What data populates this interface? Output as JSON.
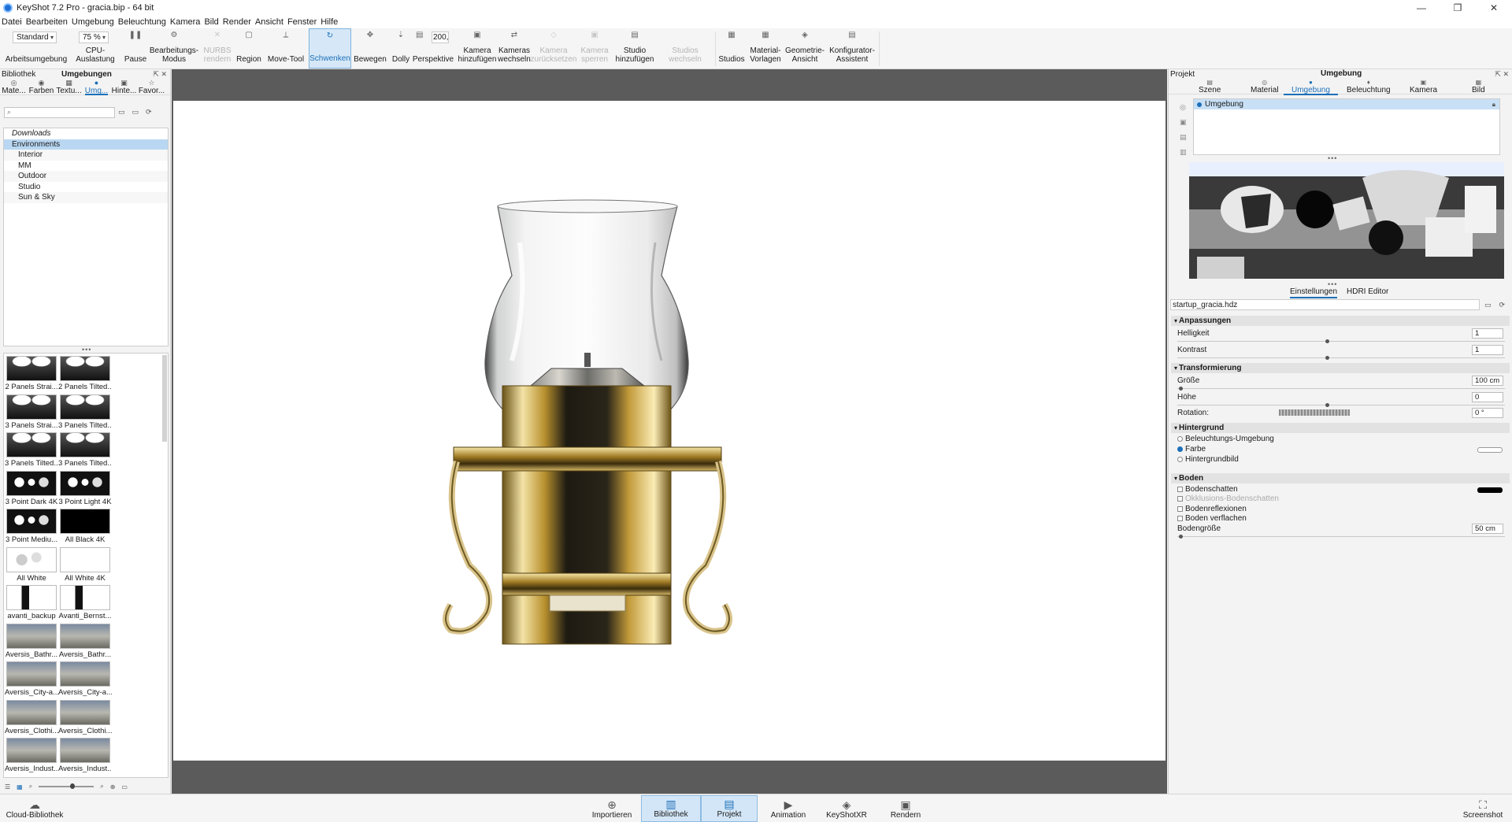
{
  "window": {
    "title": "KeyShot 7.2 Pro  - gracia.bip  - 64 bit",
    "controls": [
      "—",
      "❐",
      "✕"
    ]
  },
  "menu": [
    "Datei",
    "Bearbeiten",
    "Umgebung",
    "Beleuchtung",
    "Kamera",
    "Bild",
    "Render",
    "Ansicht",
    "Fenster",
    "Hilfe"
  ],
  "toolbar": {
    "workspace_select": "Standard",
    "cpu_select": "75 %",
    "perspective_value": "200,",
    "items": [
      {
        "label": "Arbeitsumgebung",
        "icon": "",
        "state": "normal"
      },
      {
        "label": "CPU-Auslastung",
        "icon": "",
        "state": "normal"
      },
      {
        "label": "Pause",
        "icon": "❚❚",
        "state": "normal"
      },
      {
        "label": "Bearbeitungs-\nModus",
        "icon": "⚙",
        "state": "normal"
      },
      {
        "label": "NURBS\nrendern",
        "icon": "✕",
        "state": "disabled"
      },
      {
        "label": "Region",
        "icon": "▢",
        "state": "normal"
      },
      {
        "label": "Move-Tool",
        "icon": "⟂",
        "state": "normal"
      },
      {
        "label": "Schwenken",
        "icon": "↻",
        "state": "active"
      },
      {
        "label": "Bewegen",
        "icon": "✥",
        "state": "normal"
      },
      {
        "label": "Dolly",
        "icon": "⇣",
        "state": "normal"
      },
      {
        "label": "Perspektive",
        "icon": "▤",
        "state": "normal"
      },
      {
        "label": "Kamera\nhinzufügen",
        "icon": "▣",
        "state": "normal"
      },
      {
        "label": "Kameras\nwechseln",
        "icon": "⇄",
        "state": "normal"
      },
      {
        "label": "Kamera\nzurücksetzen",
        "icon": "◇",
        "state": "disabled"
      },
      {
        "label": "Kamera\nsperren",
        "icon": "▣",
        "state": "disabled"
      },
      {
        "label": "Studio\nhinzufügen",
        "icon": "▤",
        "state": "normal"
      },
      {
        "label": "Studios wechseln",
        "icon": "",
        "state": "disabled"
      },
      {
        "label": "Studios",
        "icon": "▦",
        "state": "normal"
      },
      {
        "label": "Material-\nVorlagen",
        "icon": "▦",
        "state": "normal"
      },
      {
        "label": "Geometrie-\nAnsicht",
        "icon": "◈",
        "state": "normal"
      },
      {
        "label": "Konfigurator-\nAssistent",
        "icon": "▤",
        "state": "normal"
      }
    ]
  },
  "library": {
    "header_left": "Bibliothek",
    "header_title": "Umgebungen",
    "tabs": [
      {
        "label": "Mate...",
        "icon": "◎"
      },
      {
        "label": "Farben",
        "icon": "◉"
      },
      {
        "label": "Textu...",
        "icon": "▦"
      },
      {
        "label": "Umg...",
        "icon": "●"
      },
      {
        "label": "Hinte...",
        "icon": "▣"
      },
      {
        "label": "Favor...",
        "icon": "☆"
      }
    ],
    "search_placeholder": "⌕",
    "tree": [
      {
        "label": "Downloads",
        "level": 0,
        "italic": true
      },
      {
        "label": "Environments",
        "level": 0,
        "selected": true
      },
      {
        "label": "Interior",
        "level": 1
      },
      {
        "label": "MM",
        "level": 1
      },
      {
        "label": "Outdoor",
        "level": 1
      },
      {
        "label": "Studio",
        "level": 1
      },
      {
        "label": "Sun & Sky",
        "level": 1
      }
    ],
    "thumbnails": [
      "2 Panels Strai...",
      "2 Panels Tilted...",
      "3 Panels Strai...",
      "3 Panels Tilted...",
      "3 Panels Tilted...",
      "3 Panels Tilted...",
      "3 Point Dark 4K",
      "3 Point Light 4K",
      "3 Point Mediu...",
      "All Black 4K",
      "All White",
      "All White 4K",
      "avanti_backup",
      "Avanti_Bernst...",
      "Aversis_Bathr...",
      "Aversis_Bathr...",
      "Aversis_City-a...",
      "Aversis_City-a...",
      "Aversis_Clothi...",
      "Aversis_Clothi...",
      "Aversis_Indust...",
      "Aversis_Indust..."
    ]
  },
  "project": {
    "header_left": "Projekt",
    "header_title": "Umgebung",
    "tabs": [
      {
        "label": "Szene",
        "icon": "▤"
      },
      {
        "label": "Material",
        "icon": "◎"
      },
      {
        "label": "Umgebung",
        "icon": "●"
      },
      {
        "label": "Beleuchtung",
        "icon": "♦"
      },
      {
        "label": "Kamera",
        "icon": "▣"
      },
      {
        "label": "Bild",
        "icon": "▦"
      }
    ],
    "env_item": "Umgebung",
    "subtabs": [
      "Einstellungen",
      "HDRI Editor"
    ],
    "hdri_file": "startup_gracia.hdz",
    "sections": {
      "adjust": "Anpassungen",
      "transform": "Transformierung",
      "background": "Hintergrund",
      "ground": "Boden"
    },
    "props": {
      "brightness_label": "Helligkeit",
      "brightness_value": "1",
      "contrast_label": "Kontrast",
      "contrast_value": "1",
      "size_label": "Größe",
      "size_value": "100 cm",
      "height_label": "Höhe",
      "height_value": "0",
      "rotation_label": "Rotation:",
      "rotation_value": "0 °",
      "bg_env": "Beleuchtungs-Umgebung",
      "bg_color": "Farbe",
      "bg_image": "Hintergrundbild",
      "ground_shadows": "Bodenschatten",
      "occlusion_shadows": "Okklusions-Bodenschatten",
      "ground_reflections": "Bodenreflexionen",
      "flatten_ground": "Boden verflachen",
      "ground_size_label": "Bodengröße",
      "ground_size_value": "50 cm"
    },
    "colors": {
      "background_swatch": "#ffffff",
      "shadow_swatch": "#000000",
      "accent": "#1c6fb8"
    }
  },
  "bottom": {
    "cloud": "Cloud-Bibliothek",
    "items": [
      {
        "label": "Importieren",
        "icon": "⊕",
        "active": false
      },
      {
        "label": "Bibliothek",
        "icon": "📖",
        "active": true
      },
      {
        "label": "Projekt",
        "icon": "▤",
        "active": true
      },
      {
        "label": "Animation",
        "icon": "▶",
        "active": false
      },
      {
        "label": "KeyShotXR",
        "icon": "◈",
        "active": false
      },
      {
        "label": "Rendern",
        "icon": "▣",
        "active": false
      }
    ],
    "screenshot": "Screenshot"
  }
}
